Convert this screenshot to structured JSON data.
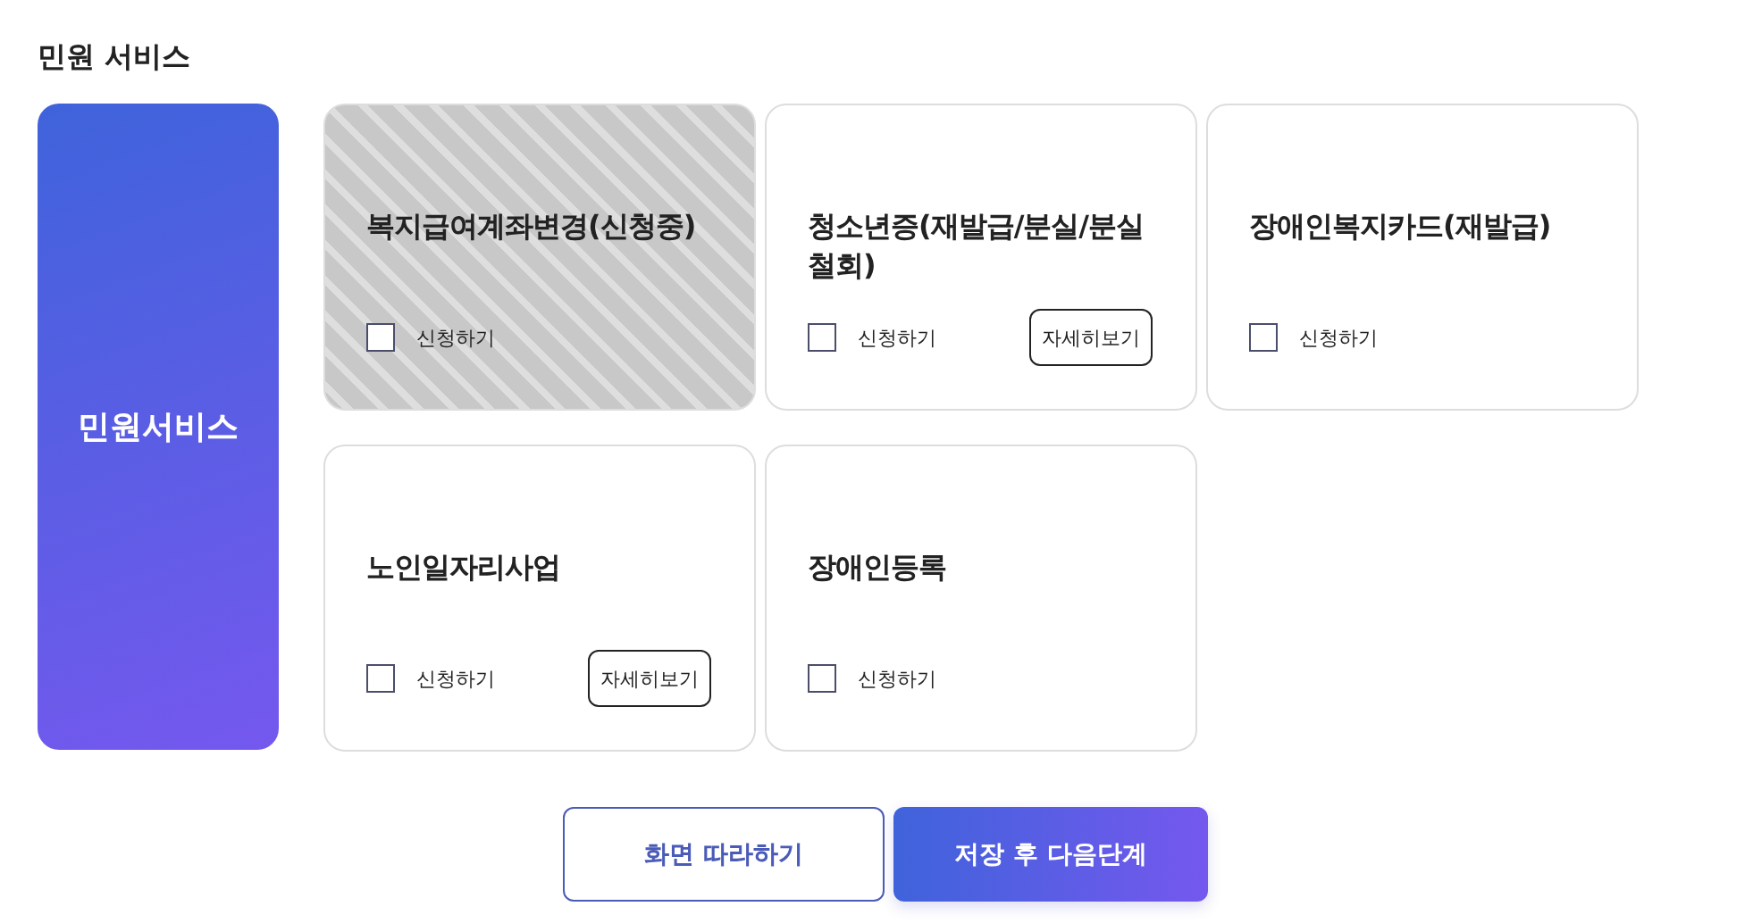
{
  "section_title": "민원 서비스",
  "category_panel": {
    "label": "민원서비스"
  },
  "services": [
    {
      "title": "복지급여계좌변경(신청중)",
      "disabled": true,
      "checked": false,
      "checkbox_label": "신청하기"
    },
    {
      "title": "청소년증(재발급/분실/분실철회)",
      "disabled": false,
      "checked": false,
      "checkbox_label": "신청하기",
      "detail_button": "자세히보기"
    },
    {
      "title": "장애인복지카드(재발급)",
      "disabled": false,
      "checked": false,
      "checkbox_label": "신청하기"
    },
    {
      "title": "노인일자리사업",
      "disabled": false,
      "checked": false,
      "checkbox_label": "신청하기",
      "detail_button": "자세히보기"
    },
    {
      "title": "장애인등록",
      "disabled": false,
      "checked": false,
      "checkbox_label": "신청하기"
    }
  ],
  "buttons": [
    {
      "label": "화면 따라하기",
      "kind": "outline"
    },
    {
      "label": "저장 후 다음단계",
      "kind": "primary"
    }
  ]
}
